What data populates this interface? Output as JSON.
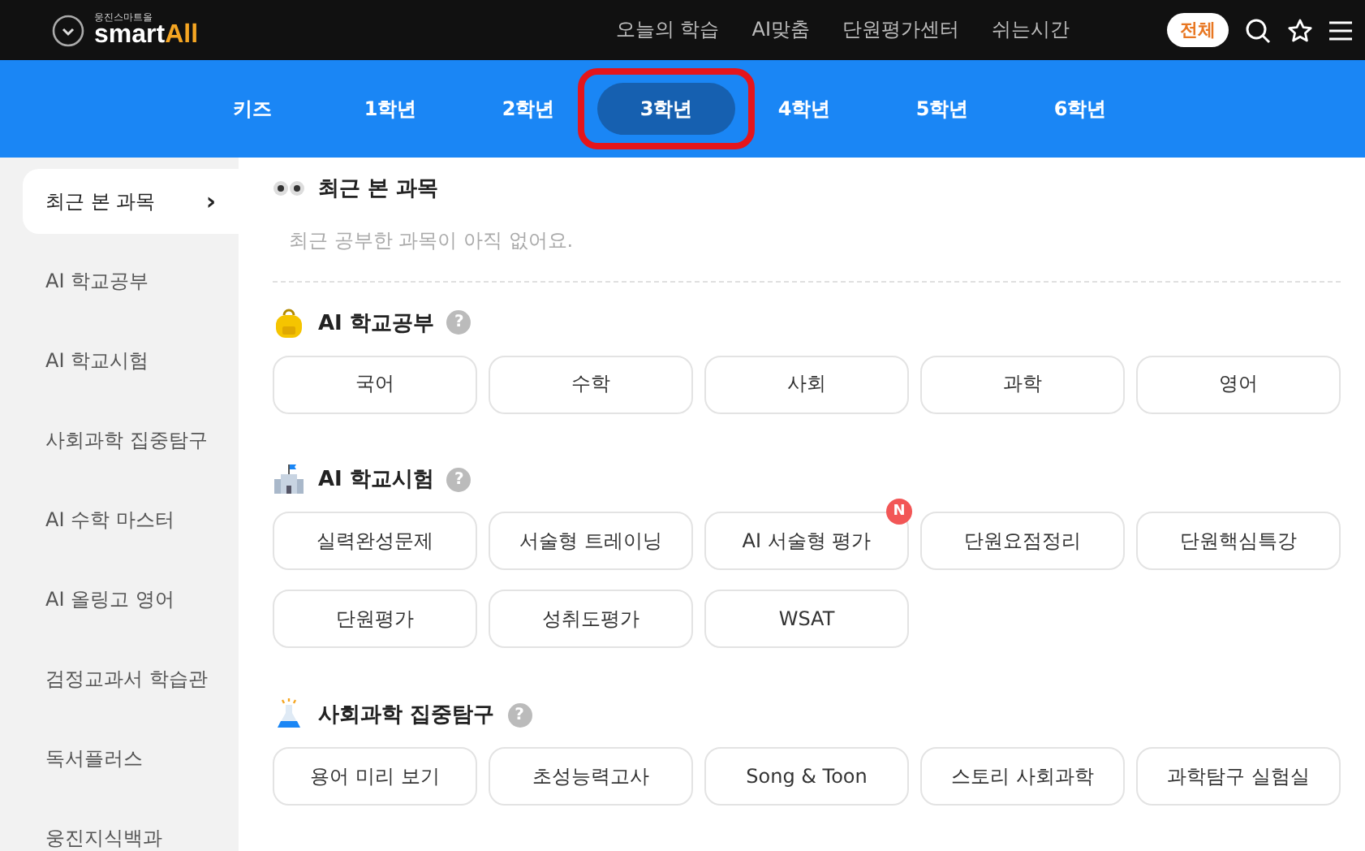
{
  "logo": {
    "caption": "웅진스마트올",
    "word": "smart",
    "accent": "All"
  },
  "top_menu": [
    "오늘의 학습",
    "AI맞춤",
    "단원평가센터",
    "쉬는시간"
  ],
  "scope_button": "전체",
  "grade_tabs": [
    {
      "label": "키즈",
      "selected": false
    },
    {
      "label": "1학년",
      "selected": false
    },
    {
      "label": "2학년",
      "selected": false
    },
    {
      "label": "3학년",
      "selected": true
    },
    {
      "label": "4학년",
      "selected": false
    },
    {
      "label": "5학년",
      "selected": false
    },
    {
      "label": "6학년",
      "selected": false
    }
  ],
  "sidebar": {
    "items": [
      {
        "label": "최근 본 과목",
        "selected": true,
        "chevron": "›"
      },
      {
        "label": "AI 학교공부",
        "selected": false
      },
      {
        "label": "AI 학교시험",
        "selected": false
      },
      {
        "label": "사회과학 집중탐구",
        "selected": false
      },
      {
        "label": "AI 수학 마스터",
        "selected": false
      },
      {
        "label": "AI 올링고 영어",
        "selected": false
      },
      {
        "label": "검정교과서 학습관",
        "selected": false
      },
      {
        "label": "독서플러스",
        "selected": false
      },
      {
        "label": "웅진지식백과",
        "selected": false
      }
    ]
  },
  "sections": [
    {
      "kind": "recent",
      "title": "최근 본 과목",
      "empty_text": "최근 공부한 과목이 아직 없어요."
    },
    {
      "kind": "backpack",
      "title": "AI 학교공부",
      "help": "?",
      "buttons": [
        {
          "label": "국어"
        },
        {
          "label": "수학"
        },
        {
          "label": "사회"
        },
        {
          "label": "과학"
        },
        {
          "label": "영어"
        }
      ]
    },
    {
      "kind": "school",
      "title": "AI 학교시험",
      "help": "?",
      "buttons": [
        {
          "label": "실력완성문제"
        },
        {
          "label": "서술형 트레이닝"
        },
        {
          "label": "AI 서술형 평가",
          "badge": "N"
        },
        {
          "label": "단원요점정리"
        },
        {
          "label": "단원핵심특강"
        },
        {
          "label": "단원평가"
        },
        {
          "label": "성취도평가"
        },
        {
          "label": "WSAT"
        }
      ]
    },
    {
      "kind": "flask",
      "title": "사회과학 집중탐구",
      "help": "?",
      "buttons": [
        {
          "label": "용어 미리 보기"
        },
        {
          "label": "초성능력고사"
        },
        {
          "label": "Song & Toon"
        },
        {
          "label": "스토리 사회과학"
        },
        {
          "label": "과학탐구 실험실"
        }
      ]
    }
  ]
}
